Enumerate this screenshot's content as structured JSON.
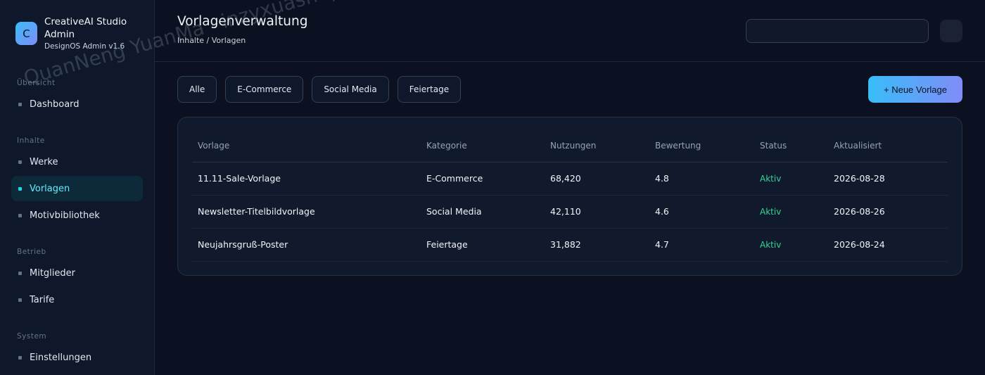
{
  "brand": {
    "logo_letter": "C",
    "title": "CreativeAI Studio Admin",
    "subtitle": "DesignOS Admin v1.6"
  },
  "sidebar": {
    "sections": [
      {
        "label": "Übersicht",
        "items": [
          {
            "label": "Dashboard",
            "active": false
          }
        ]
      },
      {
        "label": "Inhalte",
        "items": [
          {
            "label": "Werke",
            "active": false
          },
          {
            "label": "Vorlagen",
            "active": true
          },
          {
            "label": "Motivbibliothek",
            "active": false
          }
        ]
      },
      {
        "label": "Betrieb",
        "items": [
          {
            "label": "Mitglieder",
            "active": false
          },
          {
            "label": "Tarife",
            "active": false
          }
        ]
      },
      {
        "label": "System",
        "items": [
          {
            "label": "Einstellungen",
            "active": false
          }
        ]
      }
    ]
  },
  "header": {
    "title": "Vorlagenverwaltung",
    "breadcrumb": "Inhalte / Vorlagen",
    "search_value": ""
  },
  "filters": [
    "Alle",
    "E-Commerce",
    "Social Media",
    "Feiertage"
  ],
  "new_button_label": "+ Neue Vorlage",
  "table": {
    "columns": [
      "Vorlage",
      "Kategorie",
      "Nutzungen",
      "Bewertung",
      "Status",
      "Aktualisiert"
    ],
    "rows": [
      [
        "11.11-Sale-Vorlage",
        "E-Commerce",
        "68,420",
        "4.8",
        "Aktiv",
        "2026-08-28"
      ],
      [
        "Newsletter-Titelbildvorlage",
        "Social Media",
        "42,110",
        "4.6",
        "Aktiv",
        "2026-08-26"
      ],
      [
        "Neujahrsgruß-Poster",
        "Feiertage",
        "31,882",
        "4.7",
        "Aktiv",
        "2026-08-24"
      ]
    ]
  },
  "watermark": "QuanNeng YuanMa · inzyxuashop.com",
  "colors": {
    "background": "#0b1120",
    "accent_cyan": "#22d3ee",
    "status_active": "#34d399",
    "button_gradient_start": "#38bdf8",
    "button_gradient_end": "#818cf8"
  }
}
